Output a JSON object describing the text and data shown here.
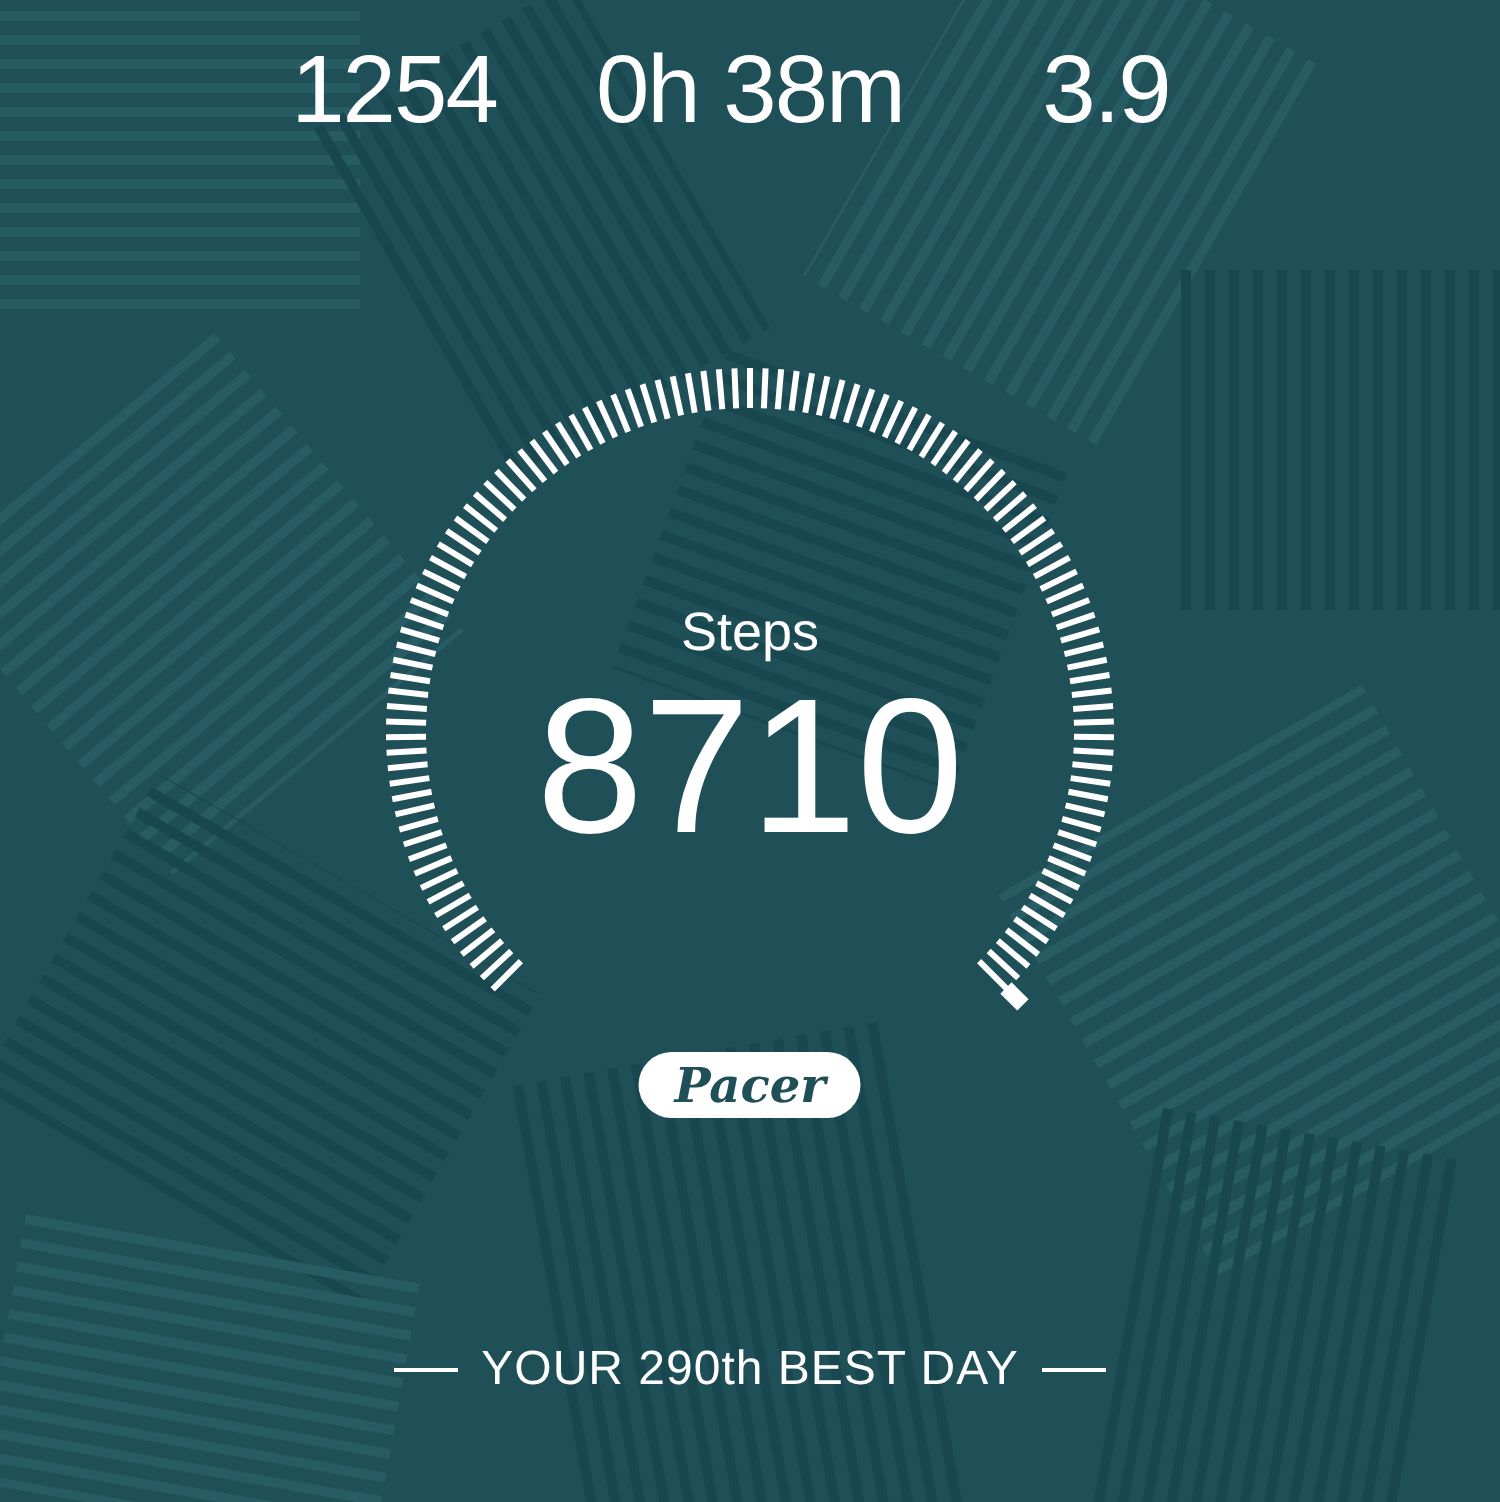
{
  "stats": [
    {
      "value": "1254"
    },
    {
      "value": "0h 38m"
    },
    {
      "value": "3.9"
    }
  ],
  "gauge": {
    "label": "Steps",
    "value": "8710"
  },
  "brand": {
    "label": "Pacer"
  },
  "footer": {
    "text": "YOUR 290th BEST DAY"
  }
}
